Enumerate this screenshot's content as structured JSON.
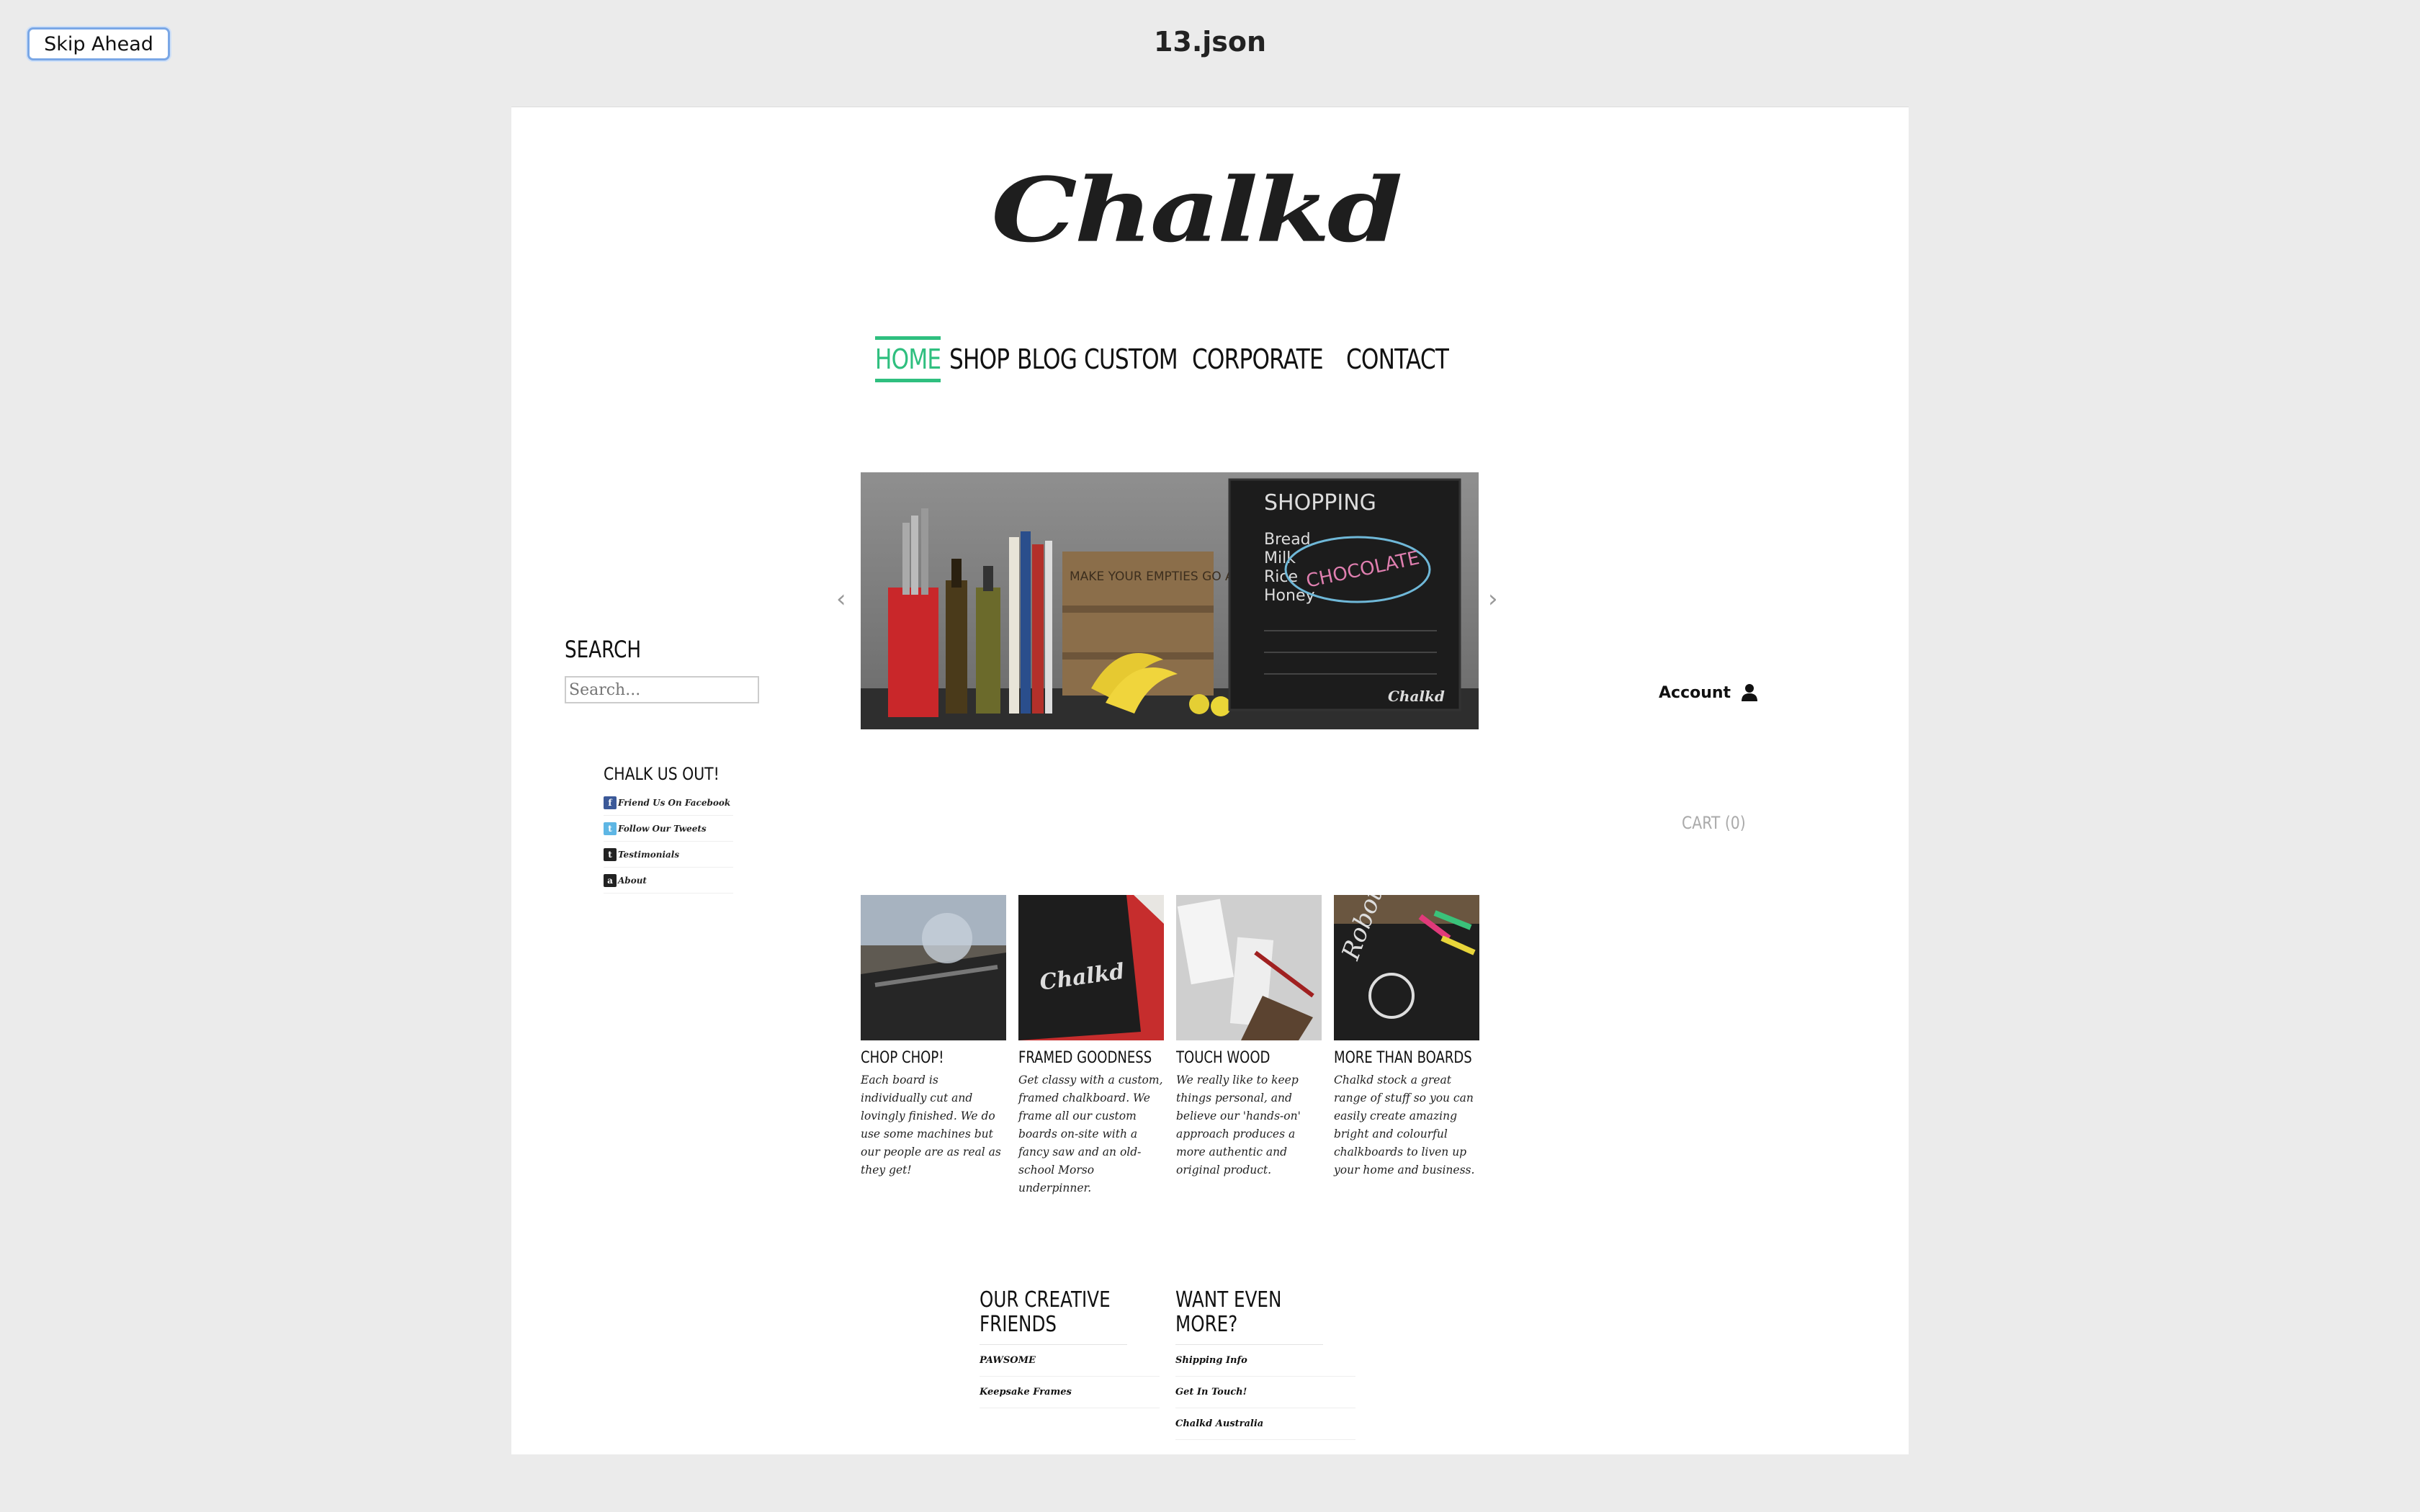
{
  "toolbar": {
    "skip_label": "Skip Ahead",
    "file_title": "13.json"
  },
  "site": {
    "logo_text": "Chalkd",
    "nav": [
      {
        "label": "HOME",
        "active": true
      },
      {
        "label": "SHOP",
        "active": false
      },
      {
        "label": "BLOG",
        "active": false
      },
      {
        "label": "CUSTOM",
        "active": false
      },
      {
        "label": "CORPORATE",
        "active": false
      },
      {
        "label": "CONTACT",
        "active": false
      }
    ],
    "accent_color": "#2fbf7f"
  },
  "sidebar": {
    "search_heading": "SEARCH",
    "search_placeholder": "Search...",
    "social_heading": "CHALK US OUT!",
    "social_links": [
      {
        "label": "Friend Us On Facebook",
        "icon": "facebook-icon"
      },
      {
        "label": "Follow Our Tweets",
        "icon": "twitter-icon"
      },
      {
        "label": "Testimonials",
        "icon": "tumblr-icon"
      },
      {
        "label": "About",
        "icon": "about-icon"
      }
    ]
  },
  "slider": {
    "chalkboard_title": "SHOPPING",
    "chalkboard_items": [
      "Bread",
      "Milk",
      "Rice",
      "Honey"
    ],
    "chalkboard_highlight": "CHOCOLATE",
    "crate_text": "MAKE YOUR EMPTIES GO AND",
    "board_brand": "Chalkd"
  },
  "account": {
    "label": "Account",
    "cart_label": "CART (0)"
  },
  "features": [
    {
      "title": "CHOP CHOP!",
      "desc": "Each board is individually cut and lovingly finished. We do use some machines but our people are as real as they get!"
    },
    {
      "title": "FRAMED GOODNESS",
      "desc": "Get classy with a custom, framed chalkboard. We frame all our custom boards on-site with a fancy saw and an old-school Morso underpinner."
    },
    {
      "title": "TOUCH WOOD",
      "desc": "We really like to keep things personal, and believe our 'hands-on' approach produces a more authentic and original product."
    },
    {
      "title": "MORE THAN BOARDS",
      "desc": "Chalkd stock a great range of stuff so you can easily create amazing bright and colourful chalkboards to liven up your home and business."
    }
  ],
  "footer": {
    "friends_heading": "OUR CREATIVE FRIENDS",
    "friends_links": [
      "PAWSOME",
      "Keepsake Frames"
    ],
    "more_heading": "WANT EVEN MORE?",
    "more_links": [
      "Shipping Info",
      "Get In Touch!",
      "Chalkd Australia"
    ]
  }
}
